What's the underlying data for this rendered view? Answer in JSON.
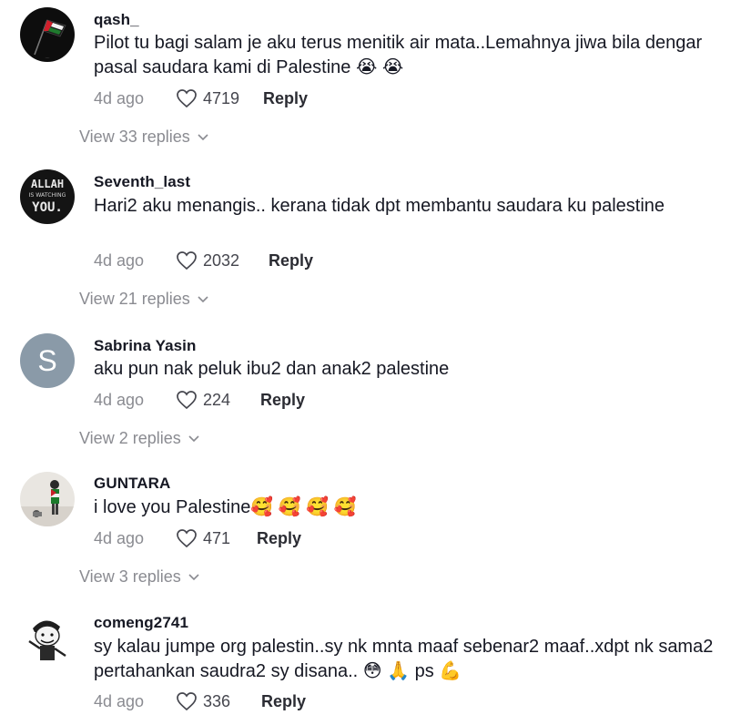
{
  "comments": [
    {
      "username": "qash_",
      "text": "Pilot tu bagi salam je aku terus menitik air mata..Lemahnya jiwa bila dengar pasal saudara kami di Palestine 😭 😭",
      "time": "4d ago",
      "likes": "4719",
      "reply": "Reply",
      "view_replies": "View 33 replies",
      "avatar_icon": "palestine-flag-avatar-icon"
    },
    {
      "username": "Seventh_last",
      "text": "Hari2 aku menangis.. kerana tidak dpt membantu saudara ku palestine",
      "time": "4d ago",
      "likes": "2032",
      "reply": "Reply",
      "view_replies": "View 21 replies",
      "avatar_icon": "allah-is-watching-you-avatar-icon",
      "avatar_text": [
        "ALLAH",
        "IS WATCHING",
        "YOU."
      ]
    },
    {
      "username": "Sabrina Yasin",
      "text": "aku pun nak peluk ibu2 dan anak2 palestine",
      "time": "4d ago",
      "likes": "224",
      "reply": "Reply",
      "view_replies": "View 2 replies",
      "avatar_letter": "S",
      "avatar_color": "#8a9aa8"
    },
    {
      "username": "GUNTARA",
      "text": "i love you Palestine🥰 🥰 🥰 🥰",
      "time": "4d ago",
      "likes": "471",
      "reply": "Reply",
      "view_replies": "View 3 replies",
      "avatar_icon": "person-with-flag-avatar-icon"
    },
    {
      "username": "comeng2741",
      "text": "sy kalau jumpe org palestin..sy nk mnta maaf sebenar2 maaf..xdpt nk sama2 pertahankan saudra2 sy disana.. 😳 🙏 ps 💪",
      "time": "4d ago",
      "likes": "336",
      "reply": "Reply",
      "avatar_icon": "cartoon-boy-avatar-icon"
    }
  ],
  "colors": {
    "text": "#161823",
    "muted": "#8a8b91",
    "letter_avatar": "#8a9aa8"
  }
}
